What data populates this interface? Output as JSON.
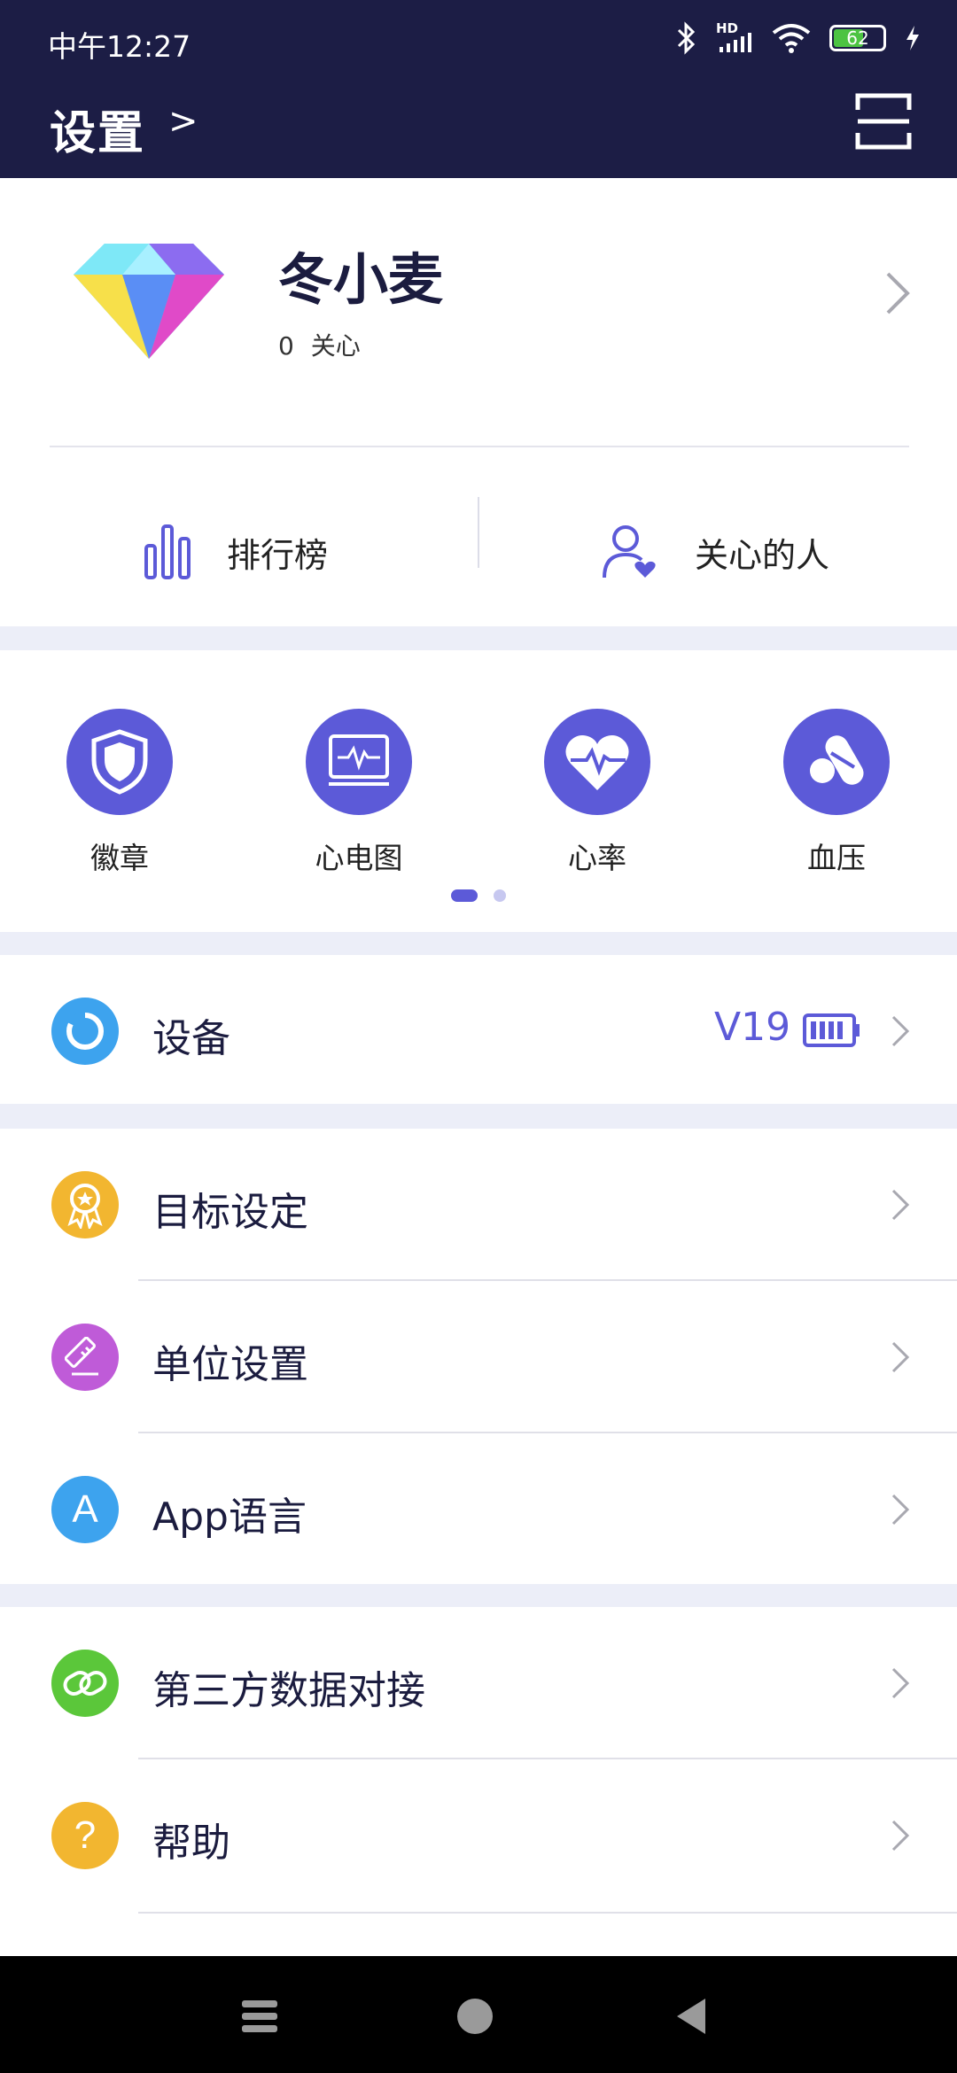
{
  "status_bar": {
    "time": "中午12:27",
    "network": "HD",
    "battery_level": "62",
    "battery_fraction": 0.62,
    "icons": [
      "bluetooth-icon",
      "cellular-signal-icon",
      "wifi-icon",
      "battery-icon",
      "charging-icon"
    ]
  },
  "header": {
    "title": "设置",
    "chevron": ">",
    "scan_icon": "scan-icon"
  },
  "profile": {
    "name": "冬小麦",
    "follow_count": "0",
    "follow_label": "关心",
    "avatar_icon": "diamond-avatar"
  },
  "quick_links": [
    {
      "label": "排行榜",
      "icon": "bar-chart-icon"
    },
    {
      "label": "关心的人",
      "icon": "person-heart-icon"
    }
  ],
  "features": [
    {
      "label": "徽章",
      "icon": "shield-icon"
    },
    {
      "label": "心电图",
      "icon": "ecg-monitor-icon"
    },
    {
      "label": "心率",
      "icon": "heart-rate-icon"
    },
    {
      "label": "血压",
      "icon": "pills-icon"
    }
  ],
  "pager": {
    "pages": 2,
    "active": 1
  },
  "device": {
    "label": "设备",
    "version": "V19",
    "icon": "device-ring-icon",
    "icon_color": "#3da3ee"
  },
  "settings_list": [
    {
      "label": "目标设定",
      "icon": "award-icon",
      "color": "#f2b630"
    },
    {
      "label": "单位设置",
      "icon": "ruler-icon",
      "color": "#bf5bd8"
    },
    {
      "label": "App语言",
      "icon": "language-icon",
      "icon_text": "A",
      "color": "#3da3ee"
    }
  ],
  "more_list": [
    {
      "label": "第三方数据对接",
      "icon": "link-icon",
      "color": "#5bc73a"
    },
    {
      "label": "帮助",
      "icon": "help-icon",
      "icon_text": "?",
      "color": "#f2b630"
    }
  ],
  "nav_bar": {
    "buttons": [
      "menu-icon",
      "home-icon",
      "back-icon"
    ]
  },
  "colors": {
    "header_bg": "#1c1d45",
    "accent": "#5c5ad8",
    "background": "#eceef8"
  }
}
